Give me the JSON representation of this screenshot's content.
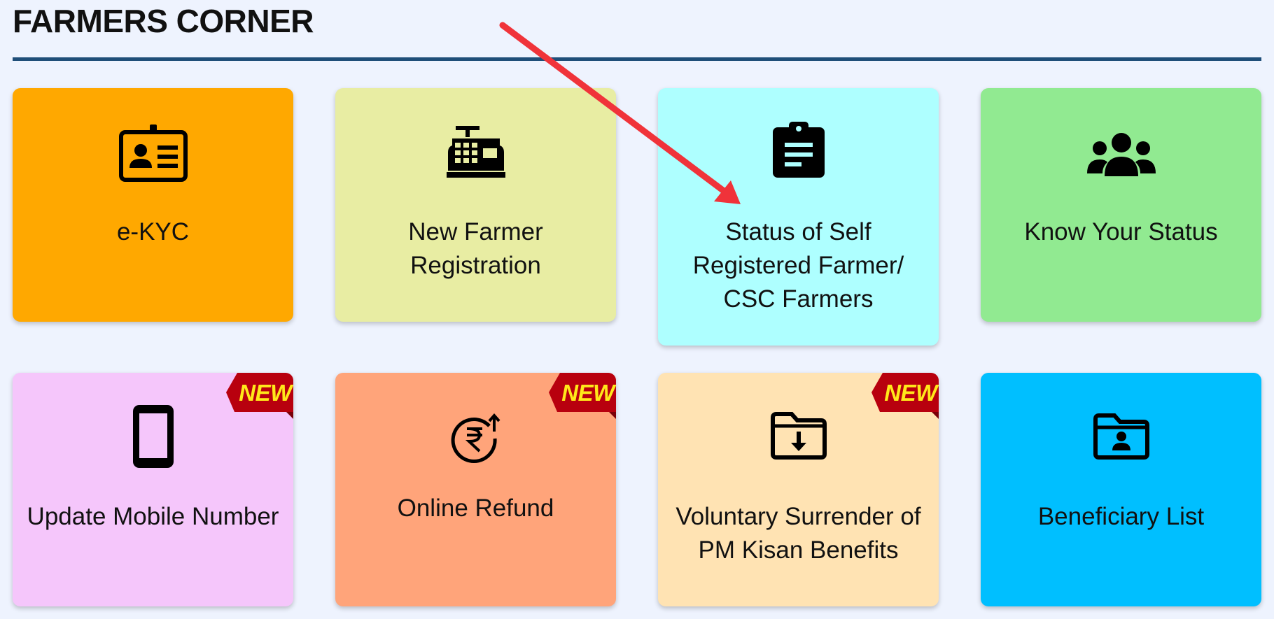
{
  "page": {
    "title": "FARMERS CORNER"
  },
  "tiles": [
    {
      "label": "e-KYC",
      "icon": "id-card-icon",
      "color": "#ffa800"
    },
    {
      "label": "New Farmer Registration",
      "icon": "cash-register-icon",
      "color": "#e8eda3"
    },
    {
      "label": "Status of Self Registered Farmer/ CSC Farmers",
      "icon": "clipboard-icon",
      "color": "#aeffff"
    },
    {
      "label": "Know Your Status",
      "icon": "users-group-icon",
      "color": "#91ea91"
    },
    {
      "label": "Update Mobile Number",
      "icon": "mobile-phone-icon",
      "color": "#f5c6fb",
      "badge": "NEW"
    },
    {
      "label": "Online Refund",
      "icon": "rupee-refund-icon",
      "color": "#ffa47a",
      "badge": "NEW"
    },
    {
      "label": "Voluntary Surrender of PM Kisan Benefits",
      "icon": "folder-download-icon",
      "color": "#ffe3b3",
      "badge": "NEW"
    },
    {
      "label": "Beneficiary List",
      "icon": "folder-user-icon",
      "color": "#00bfff"
    }
  ],
  "annotation": {
    "arrow_color": "#f0333a"
  }
}
